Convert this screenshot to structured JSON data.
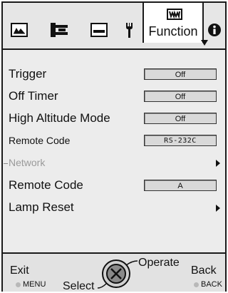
{
  "tabs": [
    {
      "name": "picture",
      "icon": "picture-icon"
    },
    {
      "name": "setup",
      "icon": "setup-icon"
    },
    {
      "name": "display",
      "icon": "display-icon"
    },
    {
      "name": "settings",
      "icon": "wrench-icon"
    },
    {
      "name": "function",
      "icon": "function-icon",
      "label": "Function",
      "active": true
    },
    {
      "name": "info",
      "icon": "info-icon"
    }
  ],
  "menu": {
    "items": [
      {
        "label": "Trigger",
        "value": "Off",
        "type": "value"
      },
      {
        "label": "Off Timer",
        "value": "Off",
        "type": "value"
      },
      {
        "label": "High Altitude Mode",
        "value": "Off",
        "type": "value"
      },
      {
        "label": "Remote Code",
        "value": "RS-232C",
        "type": "value"
      },
      {
        "label": "Network",
        "type": "submenu",
        "disabled": true
      },
      {
        "label": "Remote Code",
        "value": "A",
        "type": "value"
      },
      {
        "label": "Lamp Reset",
        "type": "submenu"
      }
    ]
  },
  "footer": {
    "exit_label": "Exit",
    "exit_hint": "MENU",
    "select_label": "Select",
    "operate_label": "Operate",
    "back_label": "Back",
    "back_hint": "BACK"
  },
  "colors": {
    "background": "#ececec",
    "border": "#1a1a1a",
    "value_box": "#d9d9d9",
    "disabled_text": "#9a9a9a",
    "active_tab": "#ffffff"
  }
}
